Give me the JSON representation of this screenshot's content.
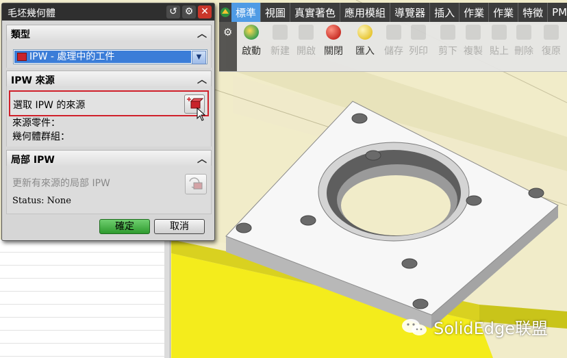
{
  "dialog": {
    "title": "毛坯幾何體",
    "sections": {
      "type": {
        "label": "類型",
        "selected": "IPW - 處理中的工件"
      },
      "source": {
        "label": "IPW 來源",
        "select_label": "選取 IPW 的來源",
        "source_part_label": "來源零件：",
        "geometry_group_label": "幾何體群組："
      },
      "local": {
        "label": "局部 IPW",
        "update_label": "更新有來源的局部 IPW",
        "status": "Status: None"
      }
    },
    "ok_label": "確定",
    "cancel_label": "取消"
  },
  "menubar": {
    "items": [
      "標準",
      "視圖",
      "真實著色",
      "應用模組",
      "導覽器",
      "插入",
      "作業",
      "作業",
      "特徵",
      "PM"
    ],
    "active_index": 0
  },
  "toolbar": {
    "items": [
      {
        "label": "啟動",
        "enabled": true,
        "icon": "start-icon"
      },
      {
        "label": "新建",
        "enabled": false,
        "icon": "new-icon"
      },
      {
        "label": "開啟",
        "enabled": false,
        "icon": "open-icon"
      },
      {
        "label": "關閉",
        "enabled": true,
        "icon": "close-doc-icon"
      },
      {
        "label": "匯入",
        "enabled": true,
        "icon": "import-icon"
      },
      {
        "label": "儲存",
        "enabled": false,
        "icon": "save-icon"
      },
      {
        "label": "列印",
        "enabled": false,
        "icon": "print-icon"
      },
      {
        "label": "剪下",
        "enabled": false,
        "icon": "cut-icon"
      },
      {
        "label": "複製",
        "enabled": false,
        "icon": "copy-icon"
      },
      {
        "label": "貼上",
        "enabled": false,
        "icon": "paste-icon"
      },
      {
        "label": "刪除",
        "enabled": false,
        "icon": "delete-icon"
      },
      {
        "label": "復原",
        "enabled": false,
        "icon": "undo-icon"
      }
    ]
  },
  "watermark": {
    "text": "SolidEdge联盟"
  },
  "colors": {
    "accent": "#3b7dd8",
    "highlight_border": "#d0202a",
    "ok_button": "#2e9a2e",
    "part": "#f7f7f7",
    "fixture_yellow": "#f4ec1c"
  }
}
